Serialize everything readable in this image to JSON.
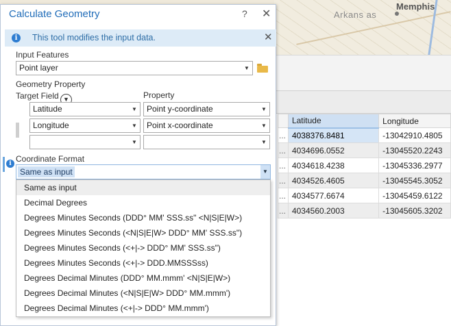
{
  "map": {
    "label_arkansas": "Arkans as",
    "label_memphis": "Memphis"
  },
  "table": {
    "headers": [
      "Latitude",
      "Longitude"
    ],
    "rows": [
      {
        "c0": "...",
        "lat": "4038376.8481",
        "lon": "-13042910.4805"
      },
      {
        "c0": "...",
        "lat": "4034696.0552",
        "lon": "-13045520.2243"
      },
      {
        "c0": "...",
        "lat": "4034618.4238",
        "lon": "-13045336.2977"
      },
      {
        "c0": "...",
        "lat": "4034526.4605",
        "lon": "-13045545.3052"
      },
      {
        "c0": "...",
        "lat": "4034577.6674",
        "lon": "-13045459.6122"
      },
      {
        "c0": "...",
        "lat": "4034560.2003",
        "lon": "-13045605.3202"
      }
    ]
  },
  "dialog": {
    "title": "Calculate Geometry",
    "help_label": "?",
    "close_label": "✕",
    "info": {
      "icon": "i",
      "text": "This tool modifies the input data.",
      "close_label": "✕"
    },
    "input_features_label": "Input Features",
    "input_features_value": "Point layer",
    "geometry_property_label": "Geometry Property",
    "target_field_label": "Target Field",
    "property_label": "Property",
    "rows": [
      {
        "field": "Latitude",
        "property": "Point y-coordinate"
      },
      {
        "field": "Longitude",
        "property": "Point x-coordinate"
      },
      {
        "field": "",
        "property": ""
      }
    ],
    "coordinate_format_label": "Coordinate Format",
    "coordinate_format_icon": "i",
    "coordinate_format_value": "Same as input",
    "options": [
      "Same as input",
      "Decimal Degrees",
      "Degrees Minutes Seconds (DDD° MM' SSS.ss\" <N|S|E|W>)",
      "Degrees Minutes Seconds  (<N|S|E|W> DDD° MM' SSS.ss\")",
      "Degrees Minutes Seconds  (<+|-> DDD° MM' SSS.ss\")",
      "Degrees Minutes Seconds (<+|-> DDD.MMSSSss)",
      "Degrees Decimal Minutes (DDD° MM.mmm' <N|S|E|W>)",
      "Degrees Decimal Minutes (<N|S|E|W> DDD° MM.mmm')",
      "Degrees Decimal Minutes (<+|-> DDD° MM.mmm')"
    ]
  },
  "colors": {
    "accent": "#1e6bb8",
    "info_bg": "#ddebf7",
    "selection": "#cfe1f5"
  }
}
